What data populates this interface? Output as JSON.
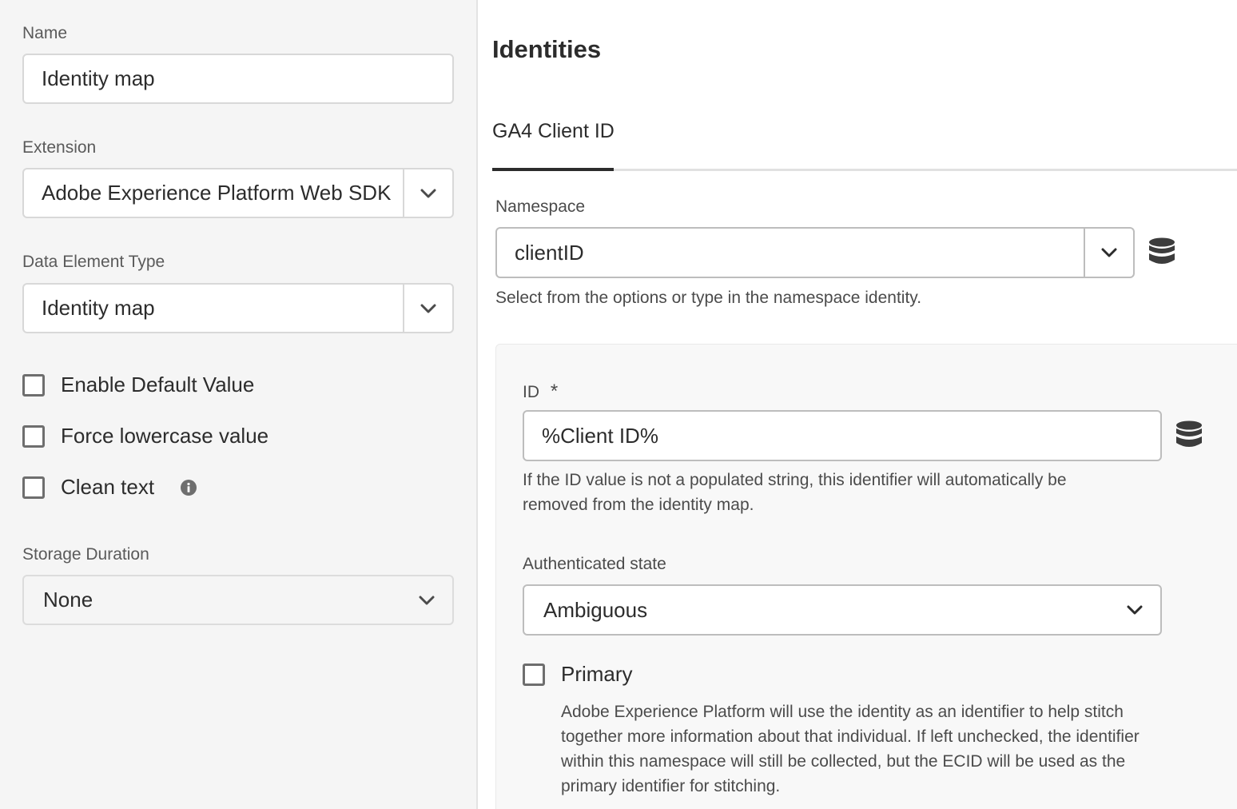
{
  "left": {
    "name": {
      "label": "Name",
      "value": "Identity map"
    },
    "extension": {
      "label": "Extension",
      "value": "Adobe Experience Platform Web SDK"
    },
    "data_element_type": {
      "label": "Data Element Type",
      "value": "Identity map"
    },
    "checkboxes": {
      "enable_default": "Enable Default Value",
      "force_lowercase": "Force lowercase value",
      "clean_text": "Clean text"
    },
    "storage_duration": {
      "label": "Storage Duration",
      "value": "None"
    }
  },
  "right": {
    "heading": "Identities",
    "tab": "GA4 Client ID",
    "namespace": {
      "label": "Namespace",
      "value": "clientID",
      "help": "Select from the options or type in the namespace identity."
    },
    "id": {
      "label": "ID",
      "required_mark": "*",
      "value": "%Client ID%",
      "help": "If the ID value is not a populated string, this identifier will automatically be removed from the identity map."
    },
    "authenticated_state": {
      "label": "Authenticated state",
      "value": "Ambiguous"
    },
    "primary": {
      "label": "Primary",
      "description": "Adobe Experience Platform will use the identity as an identifier to help stitch together more information about that individual. If left unchecked, the identifier within this namespace will still be collected, but the ECID will be used as the primary identifier for stitching."
    }
  },
  "icons": {
    "chevron": "chevron-down-icon",
    "database": "database-icon",
    "info": "info-icon"
  },
  "colors": {
    "left_bg": "#f5f5f5",
    "tab_underline": "#2c2c2c",
    "border": "#d8d8d8"
  }
}
